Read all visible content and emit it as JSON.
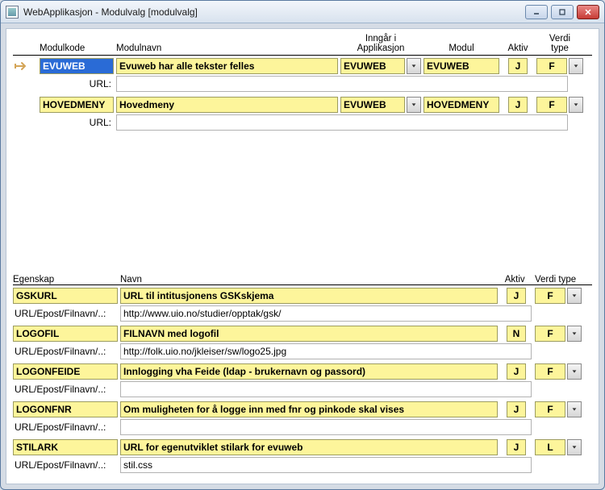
{
  "window": {
    "title": "WebApplikasjon - Modulvalg  [modulvalg]"
  },
  "topHeaders": {
    "modulkode": "Modulkode",
    "modulnavn": "Modulnavn",
    "inngar_i": "Inngår i",
    "applikasjon": "Applikasjon",
    "modul": "Modul",
    "aktiv": "Aktiv",
    "verdi": "Verdi",
    "type": "type",
    "url": "URL:"
  },
  "modules": [
    {
      "kode": "EVUWEB",
      "navn": "Evuweb har alle tekster felles",
      "applikasjon": "EVUWEB",
      "modul": "EVUWEB",
      "aktiv": "J",
      "vtype": "F",
      "url": "",
      "selected": true
    },
    {
      "kode": "HOVEDMENY",
      "navn": "Hovedmeny",
      "applikasjon": "EVUWEB",
      "modul": "HOVEDMENY",
      "aktiv": "J",
      "vtype": "F",
      "url": "",
      "selected": false
    }
  ],
  "botHeaders": {
    "egenskap": "Egenskap",
    "navn": "Navn",
    "aktiv": "Aktiv",
    "verdi": "Verdi",
    "type": "type",
    "url_label": "URL/Epost/Filnavn/..:"
  },
  "egenskaper": [
    {
      "kode": "GSKURL",
      "navn": "URL til intitusjonens GSKskjema",
      "aktiv": "J",
      "vtype": "F",
      "url": "http://www.uio.no/studier/opptak/gsk/"
    },
    {
      "kode": "LOGOFIL",
      "navn": "FILNAVN med logofil",
      "aktiv": "N",
      "vtype": "F",
      "url": "http://folk.uio.no/jkleiser/sw/logo25.jpg"
    },
    {
      "kode": "LOGONFEIDE",
      "navn": "Innlogging vha Feide (ldap - brukernavn og passord)",
      "aktiv": "J",
      "vtype": "F",
      "url": ""
    },
    {
      "kode": "LOGONFNR",
      "navn": "Om muligheten for å logge inn med fnr og pinkode skal vises",
      "aktiv": "J",
      "vtype": "F",
      "url": ""
    },
    {
      "kode": "STILARK",
      "navn": "URL for egenutviklet stilark for evuweb",
      "aktiv": "J",
      "vtype": "L",
      "url": "stil.css"
    }
  ]
}
